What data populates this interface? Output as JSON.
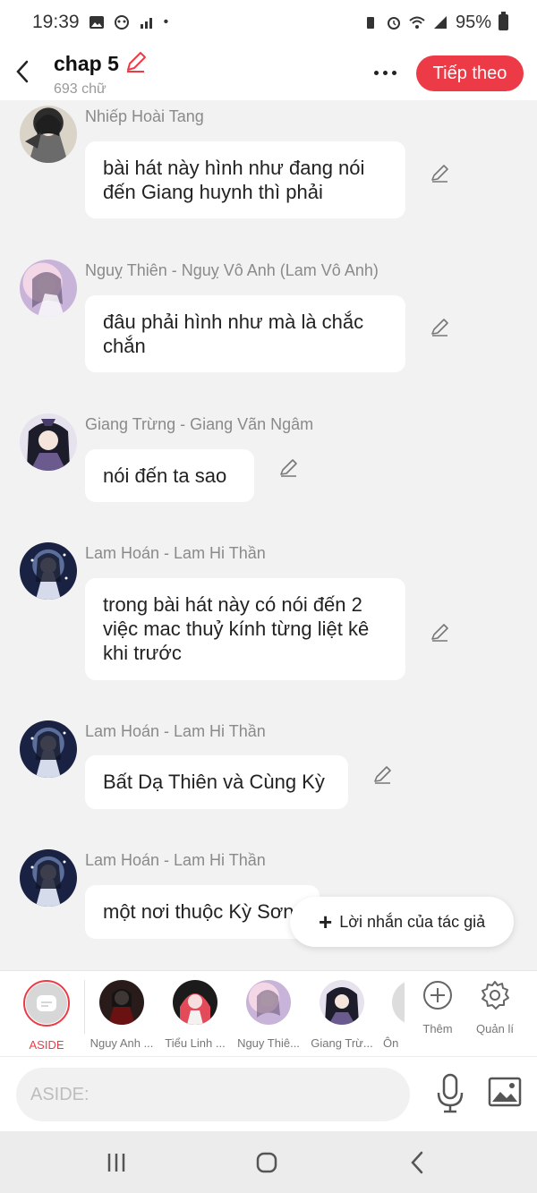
{
  "status_bar": {
    "time": "19:39",
    "battery": "95%"
  },
  "header": {
    "title": "chap 5",
    "subtitle": "693 chữ",
    "next_label": "Tiếp theo"
  },
  "messages": [
    {
      "sender": "Nhiếp Hoài Tang",
      "text": "bài hát này hình như đang nói đến Giang huynh thì phải"
    },
    {
      "sender": "Nguỵ Thiên - Nguỵ Vô Anh (Lam Vô Anh)",
      "text": "đâu phải hình như mà là chắc chắn"
    },
    {
      "sender": "Giang Trừng - Giang Vãn Ngâm",
      "text": "nói đến ta sao"
    },
    {
      "sender": "Lam Hoán - Lam Hi Thần",
      "text": "trong bài hát này có nói đến 2 việc mac thuỷ kính từng liệt kê khi trước"
    },
    {
      "sender": "Lam Hoán - Lam Hi Thần",
      "text": "Bất Dạ Thiên và Cùng Kỳ"
    },
    {
      "sender": "Lam Hoán - Lam Hi Thần",
      "text": "một nơi thuộc Kỳ Sơn"
    }
  ],
  "author_note": {
    "label": "Lời nhắn của tác giả"
  },
  "characters": [
    {
      "label": "ASIDE"
    },
    {
      "label": "Nguy Anh ..."
    },
    {
      "label": "Tiểu Linh ..."
    },
    {
      "label": "Nguy Thiê..."
    },
    {
      "label": "Giang Trừ..."
    },
    {
      "label": "Ôn"
    }
  ],
  "strip_actions": {
    "add_label": "Thêm",
    "manage_label": "Quản lí"
  },
  "input": {
    "placeholder": "ASIDE:"
  },
  "colors": {
    "accent": "#ec3b46",
    "bubble": "#ffffff",
    "background": "#f2f2f2"
  }
}
